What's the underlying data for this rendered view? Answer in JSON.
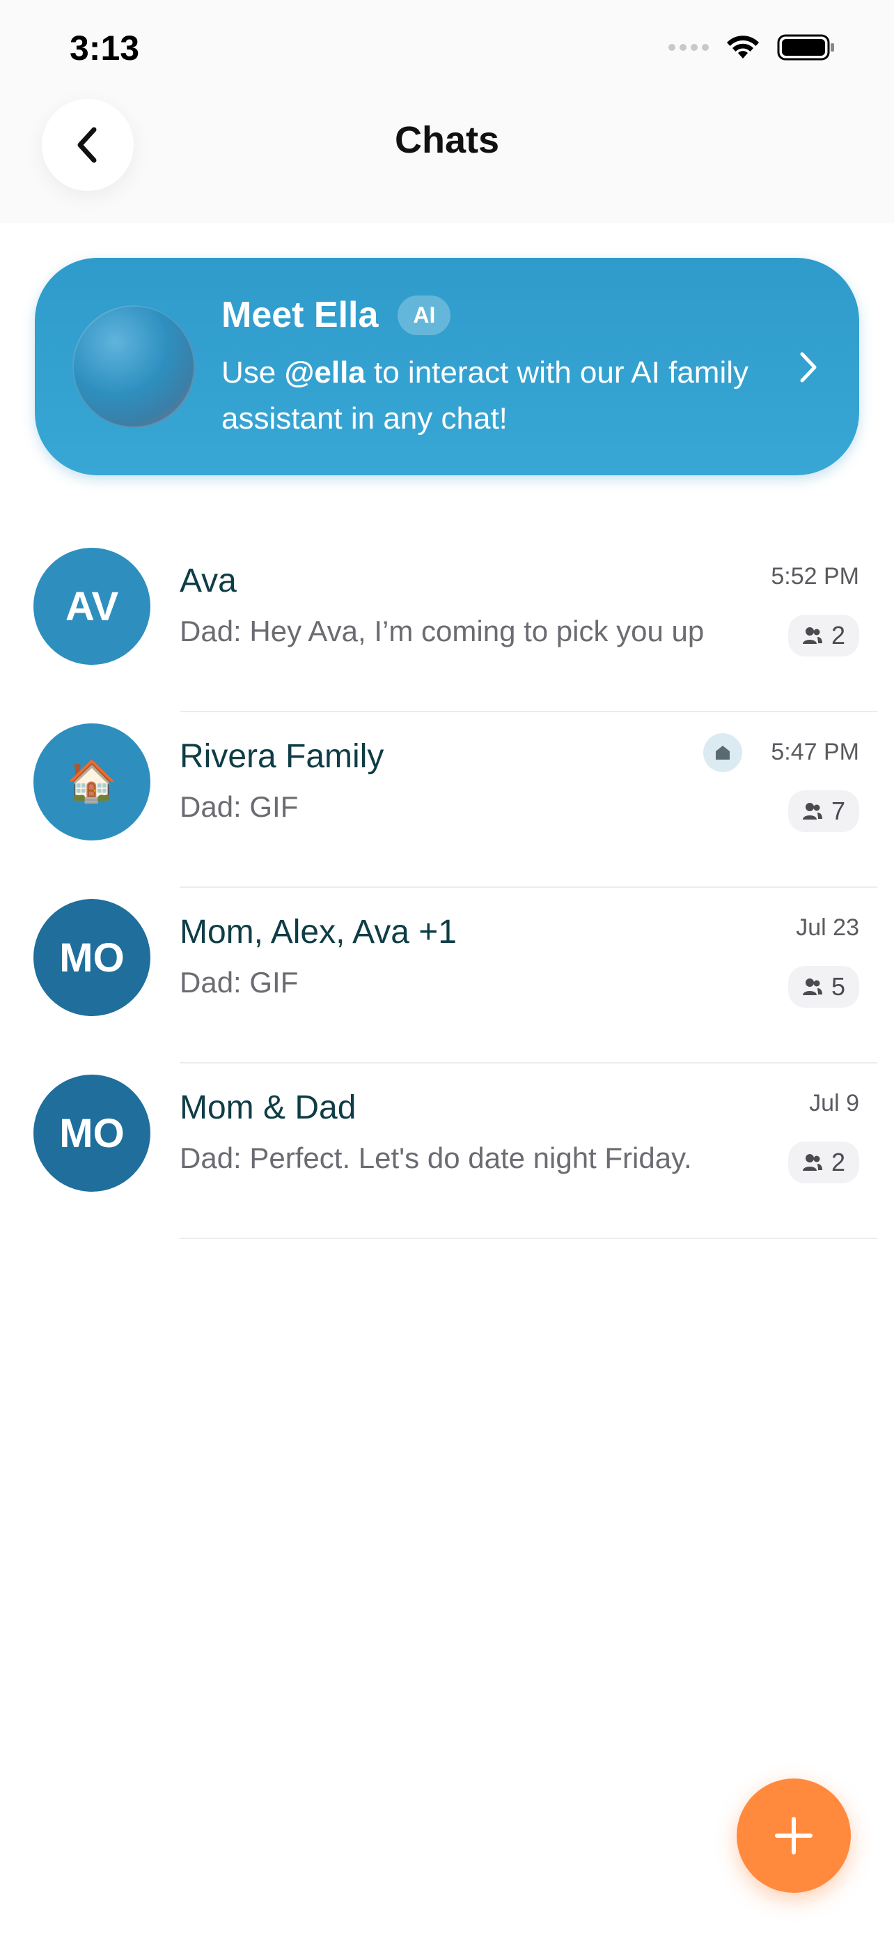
{
  "status_bar": {
    "time": "3:13"
  },
  "nav": {
    "title": "Chats",
    "back_icon": "chevron-left-icon"
  },
  "ella_banner": {
    "title": "Meet Ella",
    "badge": "AI",
    "desc_prefix": "Use ",
    "desc_mention": "@ella",
    "desc_suffix": " to interact with our AI family assistant in any chat!"
  },
  "chats": [
    {
      "avatar_text": "AV",
      "name": "Ava",
      "preview": "Dad: Hey Ava, I’m coming to pick you up",
      "time": "5:52 PM",
      "members": "2"
    },
    {
      "avatar_text": "🏠",
      "name": "Rivera Family",
      "preview": "Dad: GIF",
      "time": "5:47 PM",
      "members": "7",
      "home_indicator": "home-icon"
    },
    {
      "avatar_text": "MO",
      "name": "Mom, Alex, Ava +1",
      "preview": "Dad: GIF",
      "time": "Jul 23",
      "members": "5"
    },
    {
      "avatar_text": "MO",
      "name": "Mom & Dad",
      "preview": "Dad: Perfect. Let's do date night Friday.",
      "time": "Jul 9",
      "members": "2"
    }
  ],
  "fab": {
    "icon": "plus-icon"
  },
  "colors": {
    "banner": "#2f9bcb",
    "avatar_light": "#2e8fbf",
    "avatar_dark": "#1f6e9c",
    "fab": "#ff8a3d",
    "name_text": "#0f3d46"
  }
}
